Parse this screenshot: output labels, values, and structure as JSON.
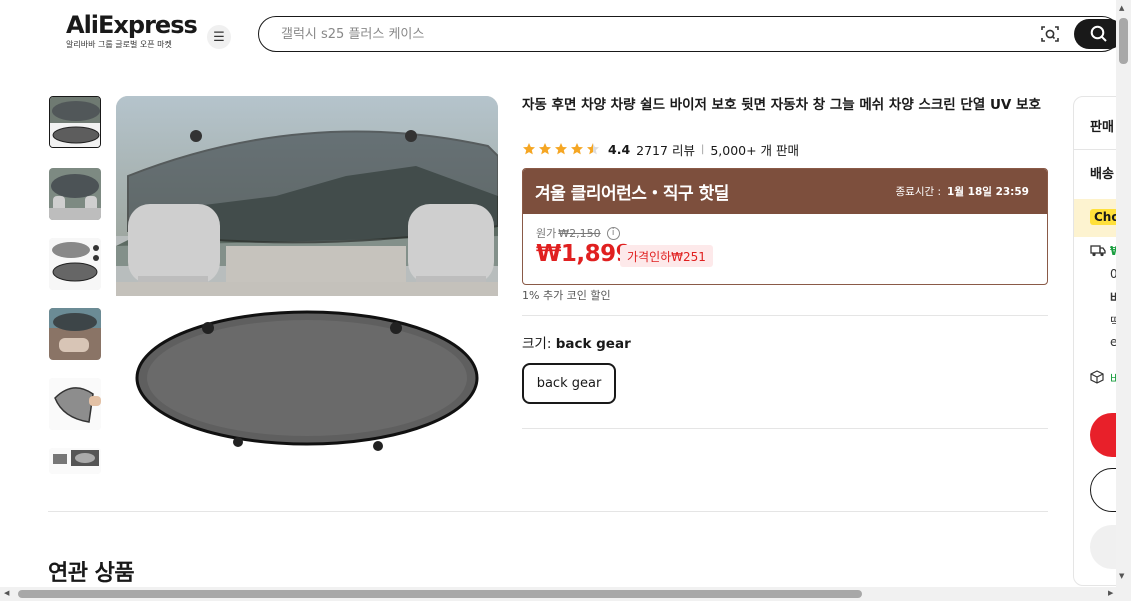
{
  "header": {
    "logo_text": "AliExpress",
    "logo_sub": "알리바바 그룹 글로벌 오픈 마켓",
    "search_placeholder": "갤럭시 s25 플러스 케이스"
  },
  "product": {
    "title": "자동 후면 차양 차량 쉴드 바이저 보호 뒷면 자동차 창 그늘 메쉬 차양 스크린 단열 UV 보호",
    "rating": "4.4",
    "stars_value": 4.5,
    "reviews": "2717 리뷰",
    "separator": "|",
    "sold": "5,000+ 개 판매"
  },
  "deal": {
    "name": "겨울 클리어런스・직구 핫딜",
    "end_label": "종료시간 :",
    "end_time": "1월 18일 23:59",
    "original_label": "원가",
    "original_price": "₩2,150",
    "price": "₩1,899",
    "discount_tag": "가격인하₩251",
    "coin_text": "1% 추가 코인 할인"
  },
  "options": {
    "size_label": "크기:",
    "size_value": "back gear",
    "size_button": "back gear"
  },
  "related_title": "연관 상품",
  "side_panel": {
    "sell_label": "판매",
    "ship_label": "배송",
    "choice_label": "Cho",
    "green_mark": "₩",
    "line1": "0",
    "line2": "바",
    "line3": "딱",
    "line4": "e",
    "returns_mark": "바"
  },
  "colors": {
    "brand_red": "#e02020",
    "deal_brown": "#7d4f3d",
    "star": "#f5a623",
    "choice_yellow": "#ffe03a",
    "green": "#1a9e3f"
  }
}
